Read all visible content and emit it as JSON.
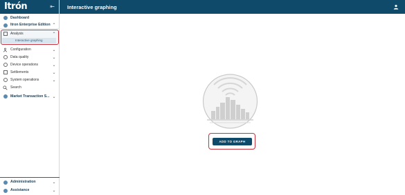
{
  "colors": {
    "header_bg": "#0f4a6b",
    "accent": "#5a8ab0",
    "highlight_outline": "#c8323c",
    "selected_bg": "#d9e6ef"
  },
  "sidebar": {
    "brand": "Itrón",
    "collapse_icon": "collapse-left-icon",
    "items": [
      {
        "label": "Dashboard",
        "icon": "dashboard-icon"
      },
      {
        "label": "Itron Enterprise Edition",
        "icon": "enterprise-icon",
        "chevron": "^"
      },
      {
        "label": "Analysis",
        "icon": "analysis-icon",
        "chevron": "^"
      },
      {
        "label": "Interactive graphing"
      },
      {
        "label": "Configuration",
        "icon": "configuration-icon",
        "chevron": "v"
      },
      {
        "label": "Data quality",
        "icon": "data-quality-icon",
        "chevron": "v"
      },
      {
        "label": "Device operations",
        "icon": "device-operations-icon",
        "chevron": "v"
      },
      {
        "label": "Settlements",
        "icon": "settlements-icon",
        "chevron": "v"
      },
      {
        "label": "System operations",
        "icon": "system-operations-icon",
        "chevron": "v"
      },
      {
        "label": "Search",
        "icon": "search-icon"
      },
      {
        "label": "Market Transaction S...",
        "icon": "market-transaction-icon",
        "chevron": "v"
      }
    ],
    "bottom_items": [
      {
        "label": "Administration",
        "icon": "administration-icon",
        "chevron": "v"
      },
      {
        "label": "Assistance",
        "icon": "assistance-icon",
        "chevron": "v"
      }
    ]
  },
  "header": {
    "title": "Interactive graphing",
    "user_icon": "user-icon"
  },
  "main": {
    "illustration": "city-skyline-illustration",
    "add_button_label": "ADD TO GRAPH"
  }
}
